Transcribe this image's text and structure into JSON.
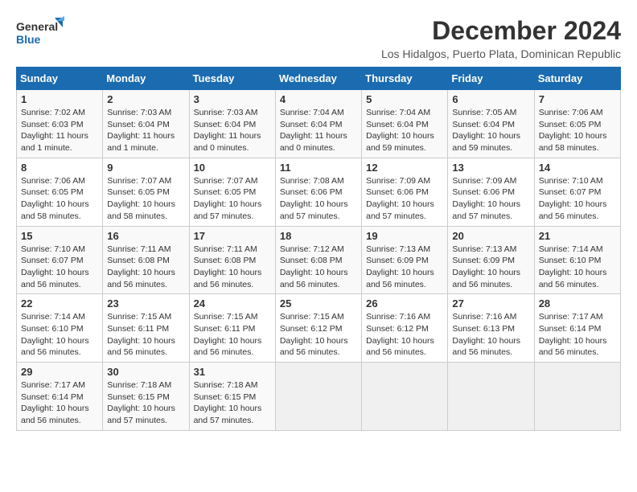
{
  "logo": {
    "line1": "General",
    "line2": "Blue"
  },
  "title": "December 2024",
  "subtitle": "Los Hidalgos, Puerto Plata, Dominican Republic",
  "weekdays": [
    "Sunday",
    "Monday",
    "Tuesday",
    "Wednesday",
    "Thursday",
    "Friday",
    "Saturday"
  ],
  "weeks": [
    [
      {
        "day": "1",
        "info": "Sunrise: 7:02 AM\nSunset: 6:03 PM\nDaylight: 11 hours\nand 1 minute."
      },
      {
        "day": "2",
        "info": "Sunrise: 7:03 AM\nSunset: 6:04 PM\nDaylight: 11 hours\nand 1 minute."
      },
      {
        "day": "3",
        "info": "Sunrise: 7:03 AM\nSunset: 6:04 PM\nDaylight: 11 hours\nand 0 minutes."
      },
      {
        "day": "4",
        "info": "Sunrise: 7:04 AM\nSunset: 6:04 PM\nDaylight: 11 hours\nand 0 minutes."
      },
      {
        "day": "5",
        "info": "Sunrise: 7:04 AM\nSunset: 6:04 PM\nDaylight: 10 hours\nand 59 minutes."
      },
      {
        "day": "6",
        "info": "Sunrise: 7:05 AM\nSunset: 6:04 PM\nDaylight: 10 hours\nand 59 minutes."
      },
      {
        "day": "7",
        "info": "Sunrise: 7:06 AM\nSunset: 6:05 PM\nDaylight: 10 hours\nand 58 minutes."
      }
    ],
    [
      {
        "day": "8",
        "info": "Sunrise: 7:06 AM\nSunset: 6:05 PM\nDaylight: 10 hours\nand 58 minutes."
      },
      {
        "day": "9",
        "info": "Sunrise: 7:07 AM\nSunset: 6:05 PM\nDaylight: 10 hours\nand 58 minutes."
      },
      {
        "day": "10",
        "info": "Sunrise: 7:07 AM\nSunset: 6:05 PM\nDaylight: 10 hours\nand 57 minutes."
      },
      {
        "day": "11",
        "info": "Sunrise: 7:08 AM\nSunset: 6:06 PM\nDaylight: 10 hours\nand 57 minutes."
      },
      {
        "day": "12",
        "info": "Sunrise: 7:09 AM\nSunset: 6:06 PM\nDaylight: 10 hours\nand 57 minutes."
      },
      {
        "day": "13",
        "info": "Sunrise: 7:09 AM\nSunset: 6:06 PM\nDaylight: 10 hours\nand 57 minutes."
      },
      {
        "day": "14",
        "info": "Sunrise: 7:10 AM\nSunset: 6:07 PM\nDaylight: 10 hours\nand 56 minutes."
      }
    ],
    [
      {
        "day": "15",
        "info": "Sunrise: 7:10 AM\nSunset: 6:07 PM\nDaylight: 10 hours\nand 56 minutes."
      },
      {
        "day": "16",
        "info": "Sunrise: 7:11 AM\nSunset: 6:08 PM\nDaylight: 10 hours\nand 56 minutes."
      },
      {
        "day": "17",
        "info": "Sunrise: 7:11 AM\nSunset: 6:08 PM\nDaylight: 10 hours\nand 56 minutes."
      },
      {
        "day": "18",
        "info": "Sunrise: 7:12 AM\nSunset: 6:08 PM\nDaylight: 10 hours\nand 56 minutes."
      },
      {
        "day": "19",
        "info": "Sunrise: 7:13 AM\nSunset: 6:09 PM\nDaylight: 10 hours\nand 56 minutes."
      },
      {
        "day": "20",
        "info": "Sunrise: 7:13 AM\nSunset: 6:09 PM\nDaylight: 10 hours\nand 56 minutes."
      },
      {
        "day": "21",
        "info": "Sunrise: 7:14 AM\nSunset: 6:10 PM\nDaylight: 10 hours\nand 56 minutes."
      }
    ],
    [
      {
        "day": "22",
        "info": "Sunrise: 7:14 AM\nSunset: 6:10 PM\nDaylight: 10 hours\nand 56 minutes."
      },
      {
        "day": "23",
        "info": "Sunrise: 7:15 AM\nSunset: 6:11 PM\nDaylight: 10 hours\nand 56 minutes."
      },
      {
        "day": "24",
        "info": "Sunrise: 7:15 AM\nSunset: 6:11 PM\nDaylight: 10 hours\nand 56 minutes."
      },
      {
        "day": "25",
        "info": "Sunrise: 7:15 AM\nSunset: 6:12 PM\nDaylight: 10 hours\nand 56 minutes."
      },
      {
        "day": "26",
        "info": "Sunrise: 7:16 AM\nSunset: 6:12 PM\nDaylight: 10 hours\nand 56 minutes."
      },
      {
        "day": "27",
        "info": "Sunrise: 7:16 AM\nSunset: 6:13 PM\nDaylight: 10 hours\nand 56 minutes."
      },
      {
        "day": "28",
        "info": "Sunrise: 7:17 AM\nSunset: 6:14 PM\nDaylight: 10 hours\nand 56 minutes."
      }
    ],
    [
      {
        "day": "29",
        "info": "Sunrise: 7:17 AM\nSunset: 6:14 PM\nDaylight: 10 hours\nand 56 minutes."
      },
      {
        "day": "30",
        "info": "Sunrise: 7:18 AM\nSunset: 6:15 PM\nDaylight: 10 hours\nand 57 minutes."
      },
      {
        "day": "31",
        "info": "Sunrise: 7:18 AM\nSunset: 6:15 PM\nDaylight: 10 hours\nand 57 minutes."
      },
      null,
      null,
      null,
      null
    ]
  ]
}
